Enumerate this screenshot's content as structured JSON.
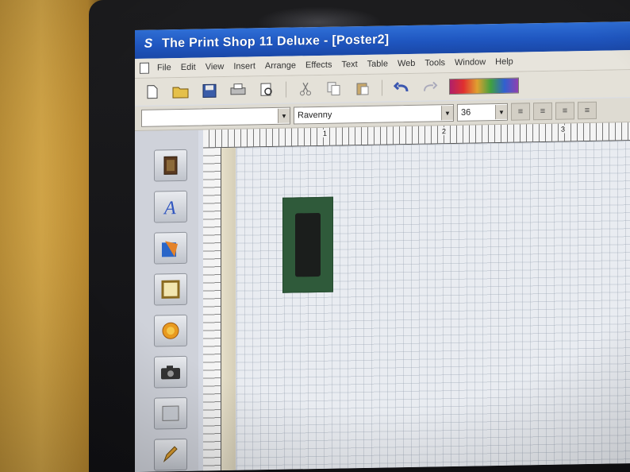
{
  "window": {
    "title": "The Print Shop 11 Deluxe - [Poster2]"
  },
  "menu": {
    "items": [
      "File",
      "Edit",
      "View",
      "Insert",
      "Arrange",
      "Effects",
      "Text",
      "Table",
      "Web",
      "Tools",
      "Window",
      "Help"
    ]
  },
  "toolbar": {
    "icons": [
      "new-document-icon",
      "open-folder-icon",
      "save-icon",
      "print-icon",
      "print-preview-icon",
      "cut-icon",
      "copy-icon",
      "paste-icon",
      "undo-icon",
      "redo-icon",
      "color-palette-icon"
    ]
  },
  "format_bar": {
    "font_name": "Ravenny",
    "font_size": "36",
    "buttons": [
      "align-left",
      "align-center",
      "align-right",
      "justify"
    ]
  },
  "ruler": {
    "top_labels": [
      "1",
      "2",
      "3"
    ]
  },
  "palette": {
    "tools": [
      "photo-tool",
      "text-tool",
      "clipart-tool",
      "border-tool",
      "shape-tool",
      "camera-tool",
      "background-tool",
      "draw-tool"
    ]
  },
  "colors": {
    "titlebar": "#2f6fd6",
    "canvas": "#e9ecf1",
    "placed_image": "#2f5a3a"
  }
}
